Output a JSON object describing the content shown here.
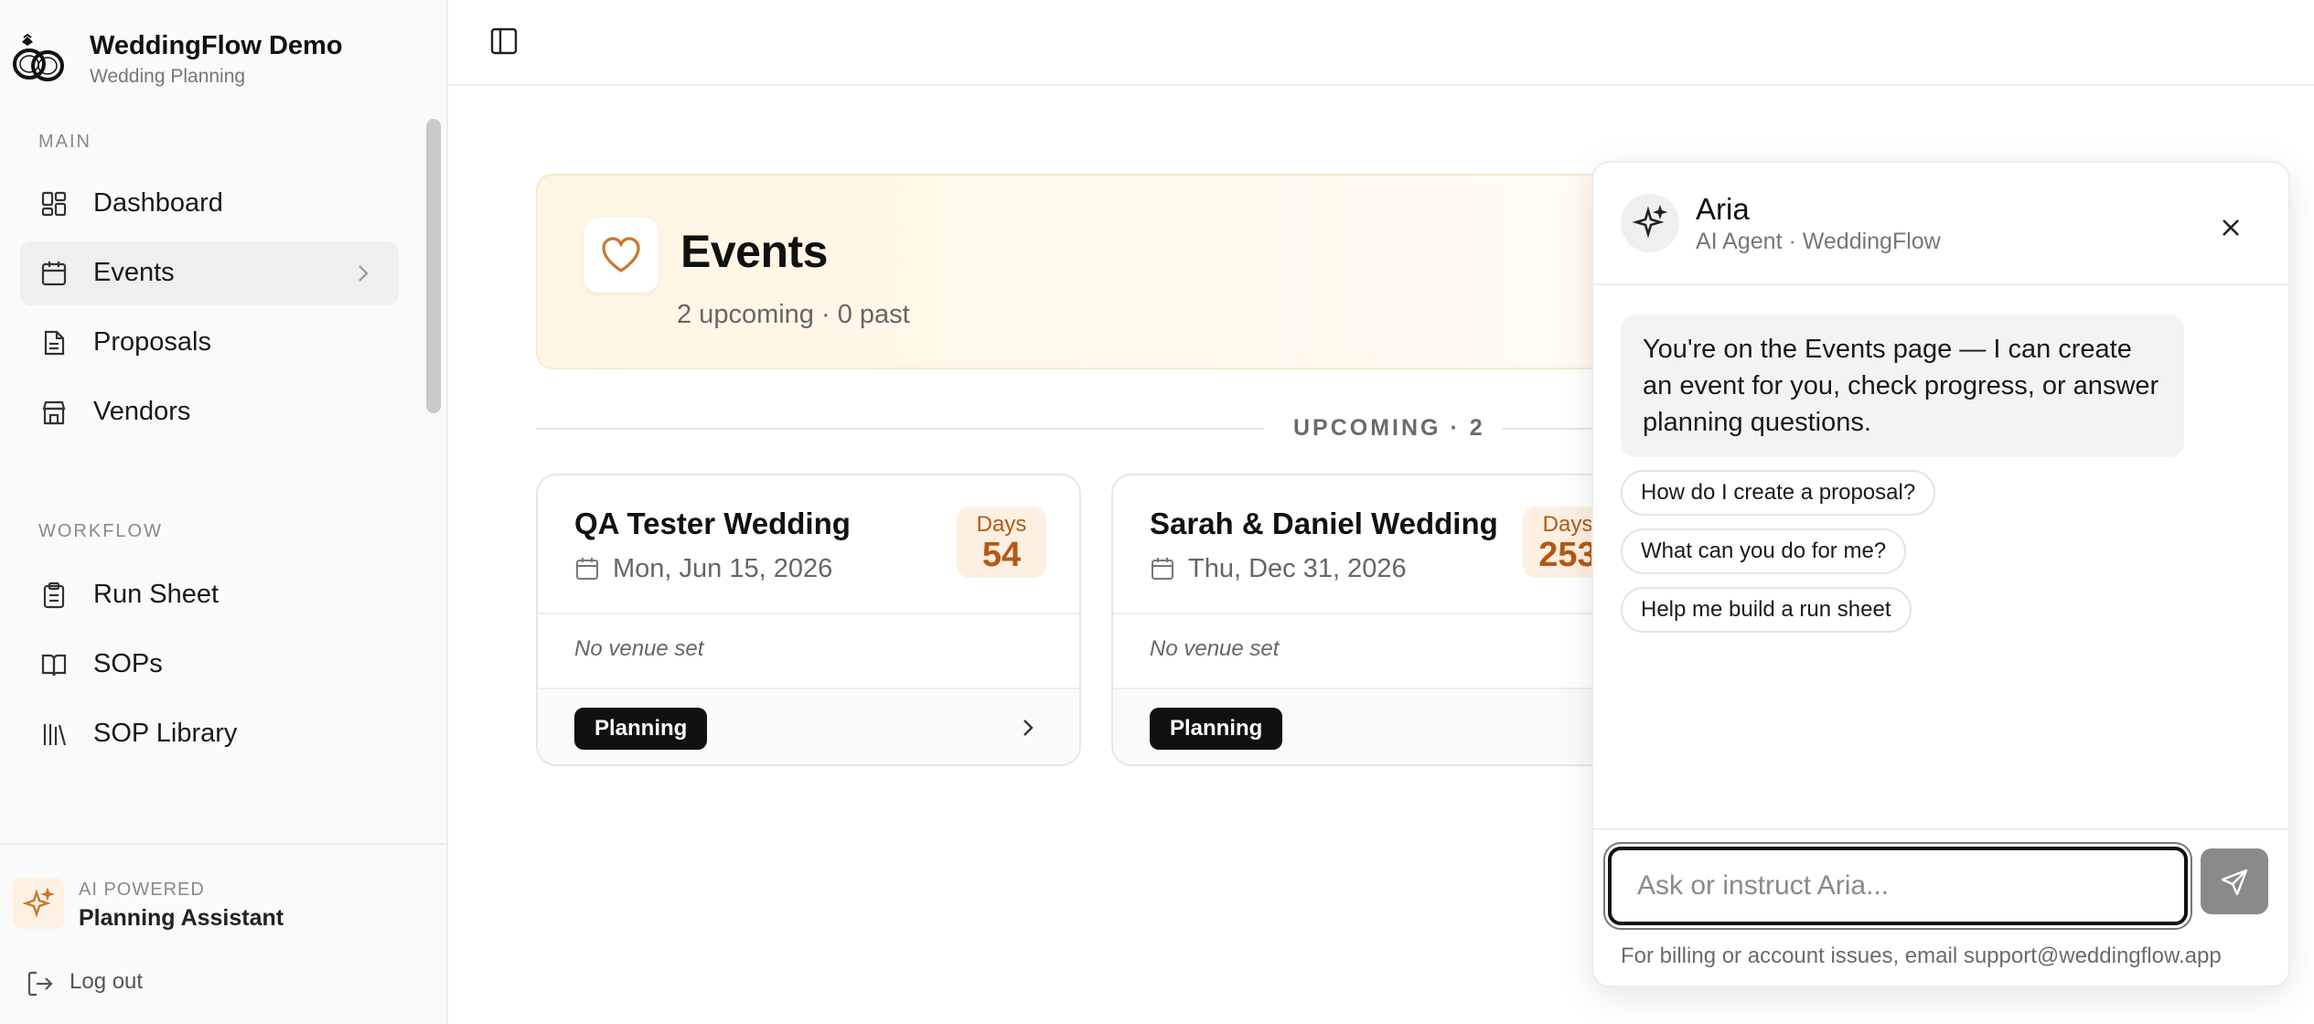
{
  "brand": {
    "name": "WeddingFlow Demo",
    "subtitle": "Wedding Planning",
    "logo_icon": "rings-icon"
  },
  "sidebar": {
    "sections": [
      {
        "label": "MAIN",
        "items": [
          {
            "label": "Dashboard",
            "icon": "grid-icon",
            "active": false
          },
          {
            "label": "Events",
            "icon": "calendar-icon",
            "active": true
          },
          {
            "label": "Proposals",
            "icon": "document-icon",
            "active": false
          },
          {
            "label": "Vendors",
            "icon": "store-icon",
            "active": false
          }
        ]
      },
      {
        "label": "WORKFLOW",
        "items": [
          {
            "label": "Run Sheet",
            "icon": "clipboard-icon",
            "active": false
          },
          {
            "label": "SOPs",
            "icon": "book-icon",
            "active": false
          },
          {
            "label": "SOP Library",
            "icon": "library-icon",
            "active": false
          }
        ]
      }
    ],
    "ai": {
      "kicker": "AI POWERED",
      "title": "Planning Assistant",
      "icon": "sparkle-icon"
    },
    "logout_label": "Log out"
  },
  "topbar": {
    "toggle_icon": "panel-left-icon"
  },
  "events": {
    "title": "Events",
    "summary": "2 upcoming · 0 past",
    "icon": "heart-icon",
    "upcoming_label": "UPCOMING · 2",
    "cards": [
      {
        "title": "QA Tester Wedding",
        "date": "Mon, Jun 15, 2026",
        "days_label": "Days",
        "days_value": "54",
        "venue": "No venue set",
        "status": "Planning"
      },
      {
        "title": "Sarah & Daniel Wedding",
        "date": "Thu, Dec 31, 2026",
        "days_label": "Days",
        "days_value": "253",
        "venue": "No venue set",
        "status": "Planning"
      }
    ]
  },
  "chat": {
    "agent_name": "Aria",
    "agent_sub": "AI Agent · WeddingFlow",
    "message": "You're on the Events page — I can create an event for you, check progress, or answer planning questions.",
    "suggestions": [
      "How do I create a proposal?",
      "What can you do for me?",
      "Help me build a run sheet"
    ],
    "input_placeholder": "Ask or instruct Aria...",
    "input_value": "",
    "footnote": "For billing or account issues, email support@weddingflow.app"
  },
  "colors": {
    "accent": "#c8782a",
    "badge_text": "#b35a14",
    "status_bg": "#111111"
  }
}
